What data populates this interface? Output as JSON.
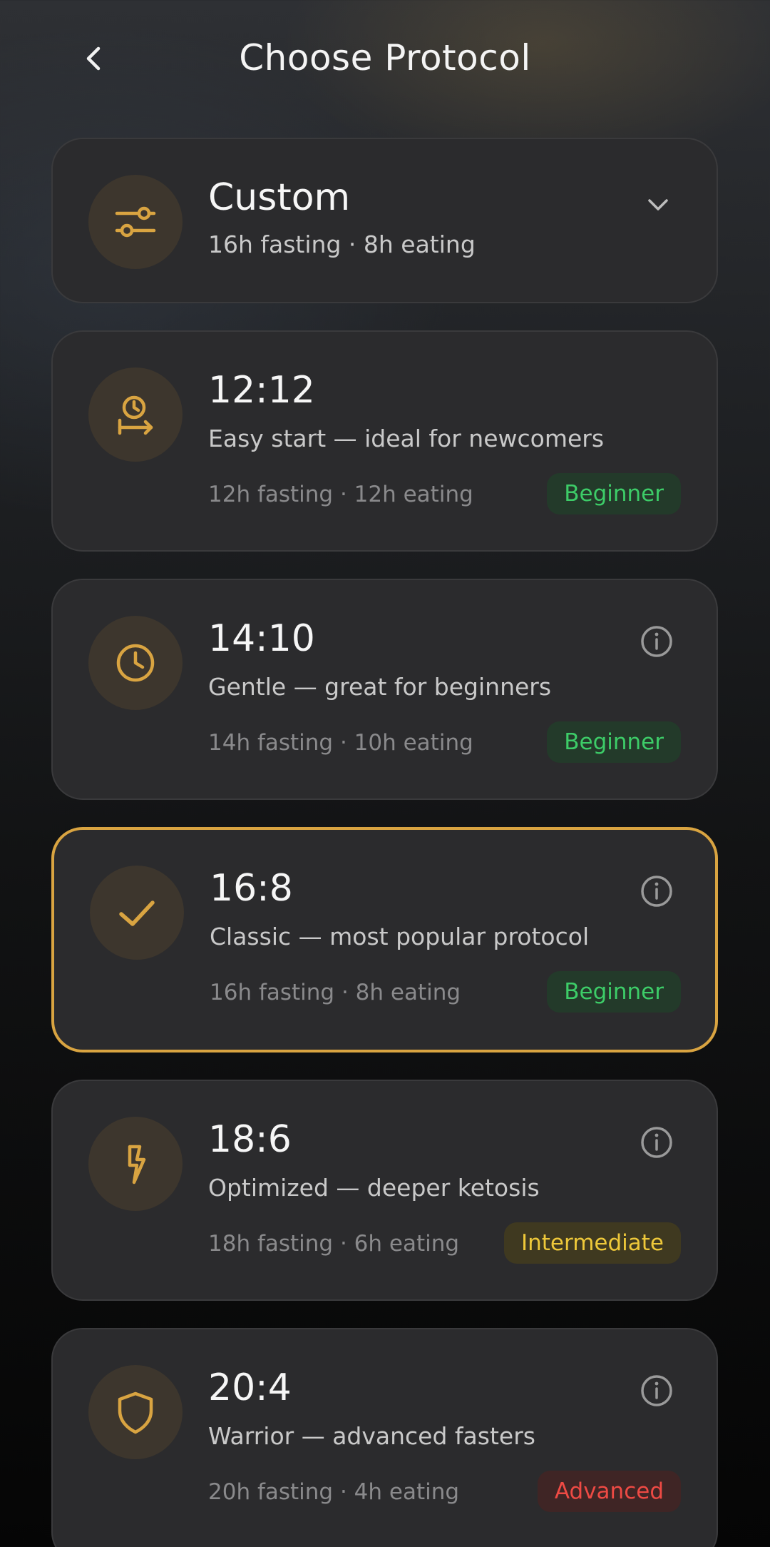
{
  "header": {
    "title": "Choose Protocol"
  },
  "custom": {
    "title": "Custom",
    "subtitle": "16h fasting · 8h eating"
  },
  "protocols": [
    {
      "title": "12:12",
      "desc": "Easy start — ideal for newcomers",
      "meta": "12h fasting · 12h eating",
      "level": "Beginner",
      "icon": "clock-arrow-icon",
      "selected": false,
      "info": false
    },
    {
      "title": "14:10",
      "desc": "Gentle — great for beginners",
      "meta": "14h fasting · 10h eating",
      "level": "Beginner",
      "icon": "clock-icon",
      "selected": false,
      "info": true
    },
    {
      "title": "16:8",
      "desc": "Classic — most popular protocol",
      "meta": "16h fasting · 8h eating",
      "level": "Beginner",
      "icon": "check-icon",
      "selected": true,
      "info": true
    },
    {
      "title": "18:6",
      "desc": "Optimized — deeper ketosis",
      "meta": "18h fasting · 6h eating",
      "level": "Intermediate",
      "icon": "lightning-icon",
      "selected": false,
      "info": true
    },
    {
      "title": "20:4",
      "desc": "Warrior — advanced fasters",
      "meta": "20h fasting · 4h eating",
      "level": "Advanced",
      "icon": "shield-icon",
      "selected": false,
      "info": true
    }
  ],
  "colors": {
    "accent": "#d9a441",
    "beginner": "#3dcc68",
    "intermediate": "#eec83a",
    "advanced": "#ee4a44"
  }
}
